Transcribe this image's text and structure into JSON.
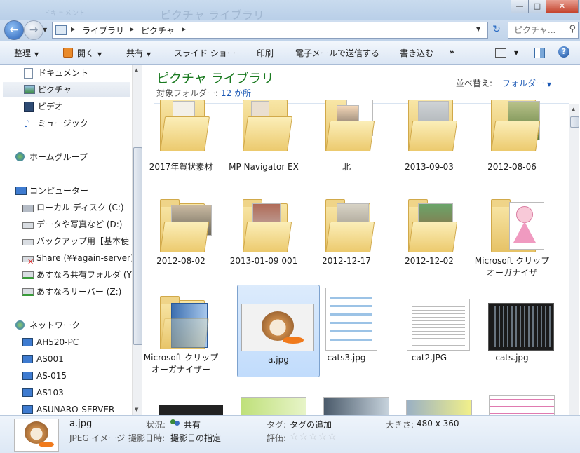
{
  "titlebar": {
    "ghost_doc": "ドキュメント",
    "ghost_title": "ピクチャ ライブラリ",
    "minimize": "—",
    "maximize": "□",
    "close": "✕"
  },
  "address": {
    "breadcrumbs": [
      "ライブラリ",
      "ピクチャ"
    ],
    "search_placeholder": "ピクチャ...",
    "refresh_icon": "↻"
  },
  "toolbar": {
    "organize": "整理",
    "open": "開く",
    "share": "共有",
    "slideshow": "スライド ショー",
    "print": "印刷",
    "email": "電子メールで送信する",
    "burn": "書き込む",
    "more": "»"
  },
  "nav": {
    "libraries": [
      {
        "label": "ドキュメント",
        "icon": "document-icon"
      },
      {
        "label": "ピクチャ",
        "icon": "picture-icon"
      },
      {
        "label": "ビデオ",
        "icon": "video-icon"
      },
      {
        "label": "ミュージック",
        "icon": "music-icon"
      }
    ],
    "homegroup": "ホームグループ",
    "computer": "コンピューター",
    "drives": [
      {
        "label": "ローカル ディスク (C:)",
        "icon": "local-disk-icon"
      },
      {
        "label": "データや写真など (D:)",
        "icon": "drive-icon"
      },
      {
        "label": "バックアップ用【基本使",
        "icon": "drive-icon"
      },
      {
        "label": "Share (¥¥again-server)",
        "icon": "disconnected-network-drive-icon"
      },
      {
        "label": "あすなろ共有フォルダ (Y",
        "icon": "network-drive-icon"
      },
      {
        "label": "あすなろサーバー (Z:)",
        "icon": "network-drive-icon"
      }
    ],
    "network": "ネットワーク",
    "network_items": [
      "AH520-PC",
      "AS001",
      "AS-015",
      "AS103",
      "ASUNARO-SERVER"
    ]
  },
  "content": {
    "title": "ピクチャ ライブラリ",
    "subtitle_prefix": "対象フォルダー: ",
    "subtitle_link": "12 か所",
    "sort_label": "並べ替え:",
    "sort_value": "フォルダー",
    "items": [
      {
        "name": "2017年賀状素材",
        "type": "folder"
      },
      {
        "name": "MP Navigator EX",
        "type": "folder"
      },
      {
        "name": "北",
        "type": "folder"
      },
      {
        "name": "2013-09-03",
        "type": "folder"
      },
      {
        "name": "2012-08-06",
        "type": "folder"
      },
      {
        "name": "2012-08-02",
        "type": "folder"
      },
      {
        "name": "2013-01-09 001",
        "type": "folder"
      },
      {
        "name": "2012-12-17",
        "type": "folder"
      },
      {
        "name": "2012-12-02",
        "type": "folder"
      },
      {
        "name": "Microsoft クリップ オーガナイザ",
        "type": "folder"
      },
      {
        "name": "Microsoft クリップ オーガナイザー",
        "type": "folder"
      },
      {
        "name": "a.jpg",
        "type": "image",
        "selected": true
      },
      {
        "name": "cats3.jpg",
        "type": "image"
      },
      {
        "name": "cat2.JPG",
        "type": "image"
      },
      {
        "name": "cats.jpg",
        "type": "image"
      }
    ]
  },
  "details": {
    "filename": "a.jpg",
    "filetype": "JPEG イメージ",
    "status_label": "状況:",
    "status_value": "共有",
    "date_label": "撮影日時:",
    "date_value": "撮影日の指定",
    "tags_label": "タグ:",
    "tags_value": "タグの追加",
    "rating_label": "評価:",
    "size_label": "大きさ:",
    "size_value": "480 x 360",
    "rating_stars": "☆☆☆☆☆"
  },
  "colors": {
    "accent_green": "#1a7a20",
    "link_blue": "#1c59b5",
    "selection": "#c1dcfc"
  }
}
